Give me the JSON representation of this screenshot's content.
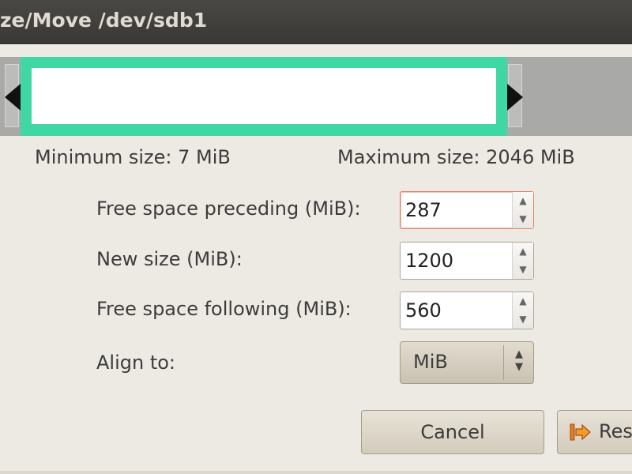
{
  "window": {
    "title": "ze/Move /dev/sdb1"
  },
  "limits": {
    "minimum": "Minimum size: 7 MiB",
    "maximum": "Maximum size: 2046 MiB"
  },
  "fields": {
    "preceding_label": "Free space preceding (MiB):",
    "preceding_value": "287",
    "new_size_label": "New size (MiB):",
    "new_size_value": "1200",
    "following_label": "Free space following (MiB):",
    "following_value": "560",
    "align_label": "Align to:",
    "align_value": "MiB"
  },
  "buttons": {
    "cancel": "Cancel",
    "resize": "Res"
  },
  "icons": {
    "resize_button_icon": "resize-arrow-icon",
    "spin_up": "▲",
    "spin_down": "▼",
    "combo_arrows": "▲▼"
  },
  "colors": {
    "partition_border": "#3fd8a4",
    "titlebar": "#3a3835",
    "focus_border": "#e0806a"
  }
}
